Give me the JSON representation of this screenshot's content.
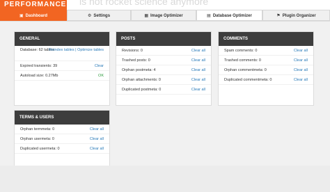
{
  "brand": {
    "title": "PERFORMANCE",
    "tagline": "is not rocket science anymore"
  },
  "tabs": [
    {
      "label": "Dashboard",
      "icon": "dashboard-icon"
    },
    {
      "label": "Settings",
      "icon": "settings-icon"
    },
    {
      "label": "Image Optimizer",
      "icon": "image-icon"
    },
    {
      "label": "Database Optimizer",
      "icon": "database-icon"
    },
    {
      "label": "Plugin Organizer",
      "icon": "plugin-icon"
    }
  ],
  "panels": {
    "general": {
      "title": "GENERAL",
      "rows": [
        {
          "label": "Database: 62 tables",
          "action": "Reindex tables | Optimize tables"
        },
        {
          "label": "Expired transients: 39",
          "action": "Clear"
        },
        {
          "label": "Autoload size: 0.27Mb",
          "action": "OK"
        }
      ]
    },
    "posts": {
      "title": "POSTS",
      "rows": [
        {
          "label": "Revisions: 0",
          "action": "Clear all"
        },
        {
          "label": "Trashed posts: 0",
          "action": "Clear all"
        },
        {
          "label": "Orphan postmeta: 4",
          "action": "Clear all"
        },
        {
          "label": "Orphan attachments: 0",
          "action": "Clear all"
        },
        {
          "label": "Duplicated postmeta: 0",
          "action": "Clear all"
        }
      ]
    },
    "comments": {
      "title": "COMMENTS",
      "rows": [
        {
          "label": "Spam comments: 0",
          "action": "Clear all"
        },
        {
          "label": "Trashed comments: 0",
          "action": "Clear all"
        },
        {
          "label": "Orphan commentmeta: 0",
          "action": "Clear all"
        },
        {
          "label": "Duplicated commentmeta: 0",
          "action": "Clear all"
        }
      ]
    },
    "terms": {
      "title": "TERMS & USERS",
      "rows": [
        {
          "label": "Orphan termmeta: 0",
          "action": "Clear all"
        },
        {
          "label": "Orphan usermeta: 0",
          "action": "Clear all"
        },
        {
          "label": "Duplicated usermeta: 0",
          "action": "Clear all"
        }
      ]
    }
  },
  "colors": {
    "accent": "#f26522",
    "header": "#3d3d3d",
    "link": "#2b7bb9",
    "ok": "#2b9a3b"
  }
}
